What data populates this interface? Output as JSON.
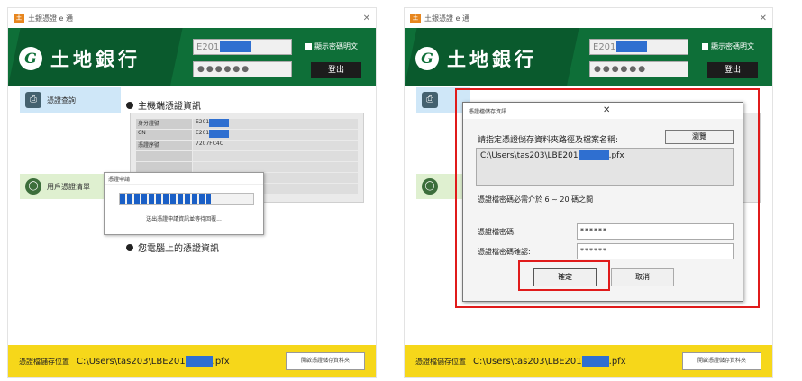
{
  "app_title": "土銀憑證 e 通",
  "brand": "土地銀行",
  "account_prefix": "E201",
  "password_mask": "●●●●●●",
  "show_password_label": "顯示密碼明文",
  "logout_label": "登出",
  "nav": {
    "cert_query": "憑證查詢",
    "user_cert_list": "用戶憑證清單"
  },
  "section_host": "主機端憑證資訊",
  "section_local": "您電腦上的憑證資訊",
  "info_rows": [
    {
      "label": "身分證號",
      "value": "E201"
    },
    {
      "label": "CN",
      "value": "E201"
    },
    {
      "label": "憑證序號",
      "value": "7207FC4C"
    }
  ],
  "progress": {
    "title": "憑證申請",
    "message": "送出憑證申請資訊並等待回覆...",
    "fraction": 0.68
  },
  "footer": {
    "label": "憑證檔儲存位置",
    "path_prefix": "C:\\Users\\tas203\\LBE201",
    "path_suffix": ".pfx",
    "open_label": "開啟憑證儲存資料夾"
  },
  "save_dialog": {
    "title": "憑證檔儲存資訊",
    "prompt": "請指定憑證儲存資料夾路徑及檔案名稱:",
    "browse": "瀏覽",
    "path_prefix": "C:\\Users\\tas203\\LBE201",
    "path_suffix": ".pfx",
    "rule": "憑證檔密碼必需介於 6 ~ 20 碼之間",
    "pw_label": "憑證檔密碼:",
    "pw_value": "******",
    "confirm_label": "憑證檔密碼確認:",
    "confirm_value": "******",
    "ok": "確定",
    "cancel": "取消"
  },
  "highlight_color": "#e01b1b"
}
